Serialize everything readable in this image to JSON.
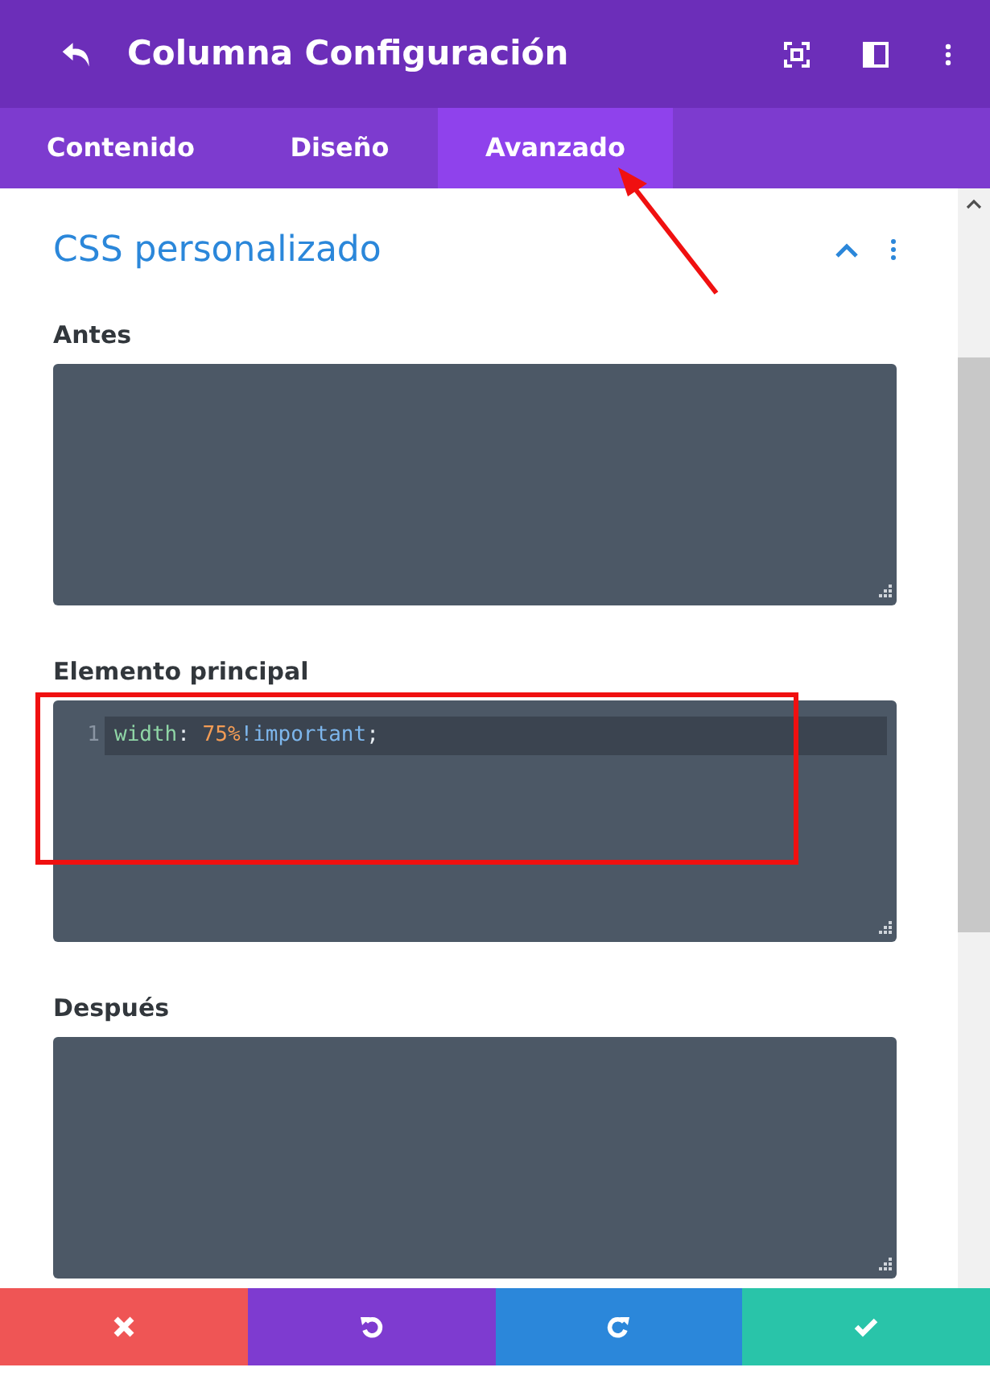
{
  "header": {
    "title": "Columna Configuración"
  },
  "tabs": [
    {
      "label": "Contenido",
      "selected": false
    },
    {
      "label": "Diseño",
      "selected": false
    },
    {
      "label": "Avanzado",
      "selected": true
    }
  ],
  "section": {
    "title": "CSS personalizado",
    "expanded": true
  },
  "fields": [
    {
      "label": "Antes"
    },
    {
      "label": "Elemento principal",
      "lines": [
        {
          "number": "1",
          "active": true,
          "tokens": [
            {
              "kind": "property",
              "text": "width"
            },
            {
              "kind": "punct",
              "text": ": "
            },
            {
              "kind": "number",
              "text": "75%"
            },
            {
              "kind": "keyword",
              "text": "!important"
            },
            {
              "kind": "punct",
              "text": ";"
            }
          ]
        }
      ]
    },
    {
      "label": "Después"
    }
  ],
  "footer_buttons": [
    {
      "kind": "cancel"
    },
    {
      "kind": "undo"
    },
    {
      "kind": "redo"
    },
    {
      "kind": "save"
    }
  ],
  "annotations": {
    "highlight_box": true,
    "arrow": true
  }
}
